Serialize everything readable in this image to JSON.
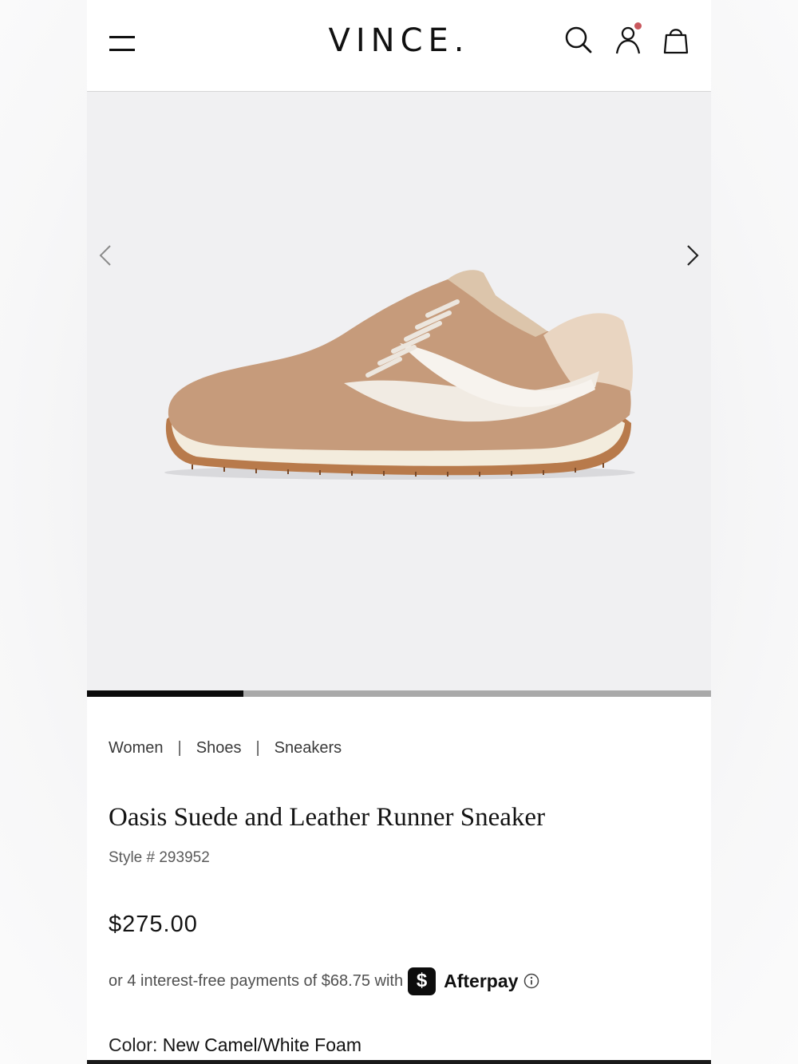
{
  "header": {
    "brand": "VINCE.",
    "menu_icon": "hamburger-menu-icon",
    "search_icon": "search-icon",
    "account_icon": "account-icon",
    "bag_icon": "shopping-bag-icon",
    "notification_color": "#c9585e"
  },
  "gallery": {
    "prev_icon": "chevron-left-icon",
    "next_icon": "chevron-right-icon",
    "image_icon": "sneaker-product-image",
    "progress_fraction": 0.25
  },
  "breadcrumb": [
    "Women",
    "Shoes",
    "Sneakers"
  ],
  "breadcrumb_separator": "|",
  "product": {
    "title": "Oasis Suede and Leather Runner Sneaker",
    "style": "Style # 293952",
    "price": "$275.00",
    "installment_text": "or 4 interest-free payments of $68.75 with",
    "afterpay_logo_glyph": "$",
    "afterpay_name": "Afterpay",
    "color_label": "Color: ",
    "color_value": "New Camel/White Foam"
  }
}
